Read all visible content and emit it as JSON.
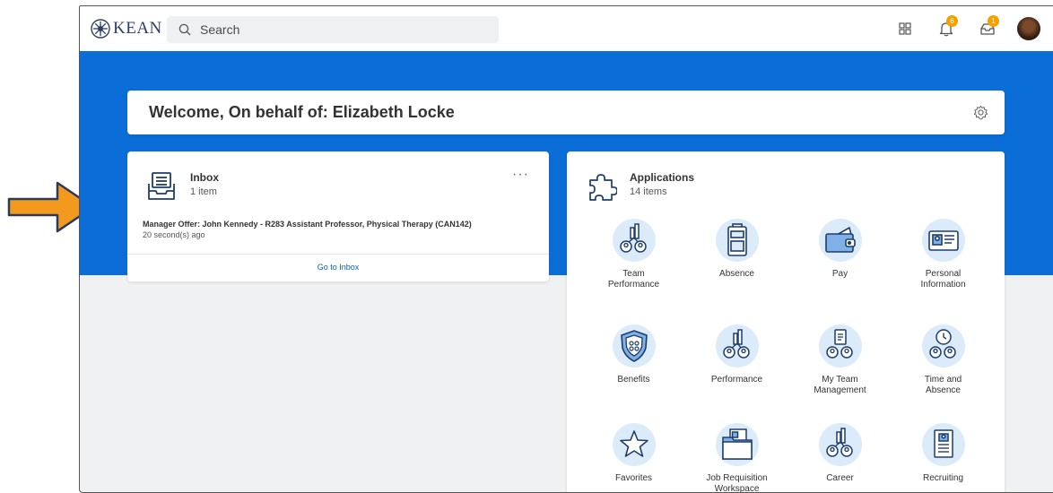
{
  "header": {
    "logo_text": "KEAN",
    "search_placeholder": "Search",
    "notifications_count": "6",
    "inbox_count": "1"
  },
  "welcome": {
    "title": "Welcome, On behalf of: Elizabeth Locke"
  },
  "inbox_card": {
    "title": "Inbox",
    "count": "1 item",
    "message_title": "Manager Offer: John Kennedy - R283 Assistant Professor, Physical Therapy (CAN142)",
    "message_time": "20 second(s) ago",
    "go_to_label": "Go to Inbox"
  },
  "applications_card": {
    "title": "Applications",
    "count": "14 items",
    "items": [
      {
        "label": "Team\nPerformance",
        "icon": "team-chart-icon"
      },
      {
        "label": "Absence",
        "icon": "luggage-icon"
      },
      {
        "label": "Pay",
        "icon": "wallet-icon"
      },
      {
        "label": "Personal\nInformation",
        "icon": "id-card-icon"
      },
      {
        "label": "Benefits",
        "icon": "shield-icon"
      },
      {
        "label": "Performance",
        "icon": "team-chart-icon"
      },
      {
        "label": "My Team\nManagement",
        "icon": "team-clipboard-icon"
      },
      {
        "label": "Time and\nAbsence",
        "icon": "team-clock-icon"
      },
      {
        "label": "Favorites",
        "icon": "star-icon"
      },
      {
        "label": "Job Requisition\nWorkspace",
        "icon": "folder-icon"
      },
      {
        "label": "Career",
        "icon": "team-chart-icon"
      },
      {
        "label": "Recruiting",
        "icon": "resume-icon"
      }
    ]
  },
  "colors": {
    "brand_blue": "#0b6ed8",
    "badge_orange": "#f4a000",
    "arrow_orange": "#f39a1e"
  }
}
